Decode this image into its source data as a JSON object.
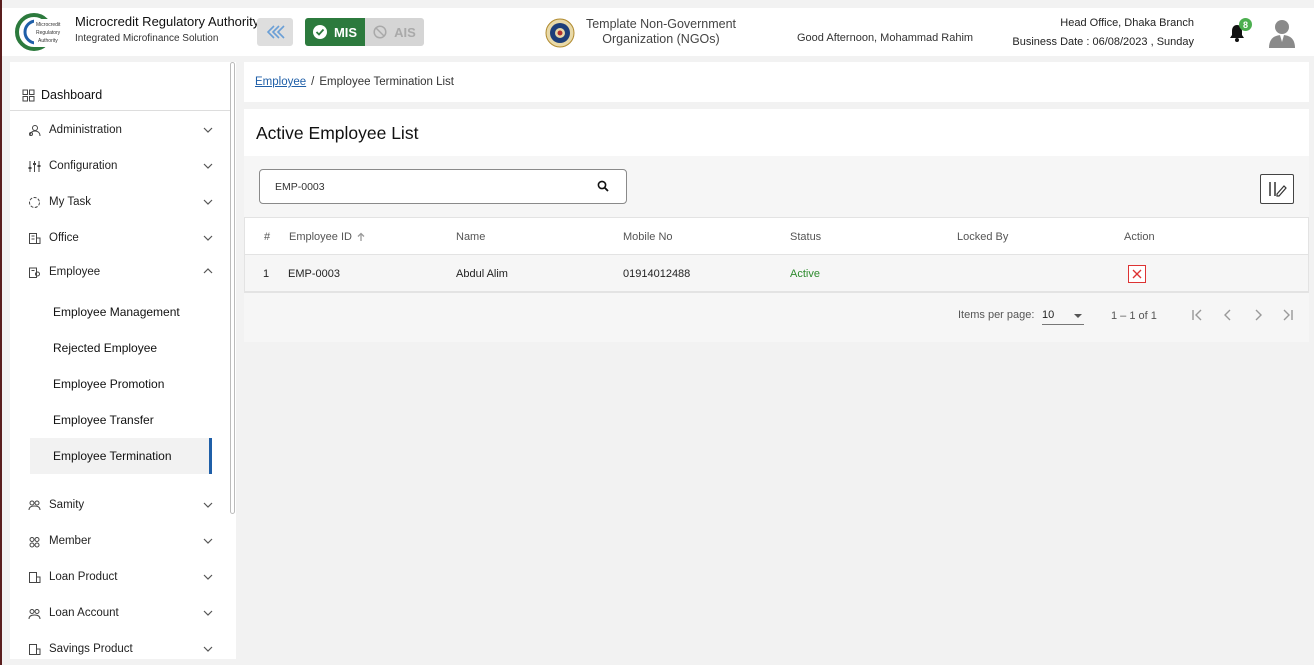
{
  "header": {
    "brand_title": "Microcredit Regulatory Authority",
    "brand_subtitle": "Integrated Microfinance Solution",
    "logo_text": [
      "Microcredit",
      "Regulatory",
      "Authority"
    ],
    "mis_label": "MIS",
    "ais_label": "AIS",
    "org_name_line1": "Template Non-Government",
    "org_name_line2": "Organization (NGOs)",
    "greeting": "Good Afternoon, Mohammad Rahim",
    "branch": "Head Office, Dhaka Branch",
    "business_date": "Business Date : 06/08/2023 , Sunday",
    "notification_count": "8",
    "colors": {
      "mis_green": "#2c7a3d",
      "badge_green": "#4caf50"
    }
  },
  "sidebar": {
    "dashboard": "Dashboard",
    "items": [
      {
        "label": "Administration",
        "icon": "admin-icon"
      },
      {
        "label": "Configuration",
        "icon": "sliders-icon"
      },
      {
        "label": "My Task",
        "icon": "task-icon"
      },
      {
        "label": "Office",
        "icon": "office-icon"
      },
      {
        "label": "Employee",
        "icon": "employee-icon",
        "expanded": true
      }
    ],
    "employee_sub": [
      "Employee Management",
      "Rejected Employee",
      "Employee Promotion",
      "Employee Transfer",
      "Employee Termination"
    ],
    "items_after": [
      {
        "label": "Samity",
        "icon": "samity-icon"
      },
      {
        "label": "Member",
        "icon": "member-icon"
      },
      {
        "label": "Loan Product",
        "icon": "loan-product-icon"
      },
      {
        "label": "Loan Account",
        "icon": "loan-account-icon"
      },
      {
        "label": "Savings Product",
        "icon": "savings-product-icon"
      }
    ],
    "active_sub": "Employee Termination"
  },
  "breadcrumb": {
    "link": "Employee",
    "separator": "/",
    "current": "Employee Termination List"
  },
  "page_title": "Active Employee List",
  "search": {
    "value": "EMP-0003"
  },
  "table": {
    "headers": [
      "#",
      "Employee ID",
      "Name",
      "Mobile No",
      "Status",
      "Locked By",
      "Action"
    ],
    "rows": [
      {
        "num": "1",
        "employee_id": "EMP-0003",
        "name": "Abdul Alim",
        "mobile": "01914012488",
        "status": "Active",
        "locked_by": ""
      }
    ]
  },
  "paginator": {
    "items_per_page_label": "Items per page:",
    "items_per_page": "10",
    "range": "1 – 1 of 1"
  }
}
